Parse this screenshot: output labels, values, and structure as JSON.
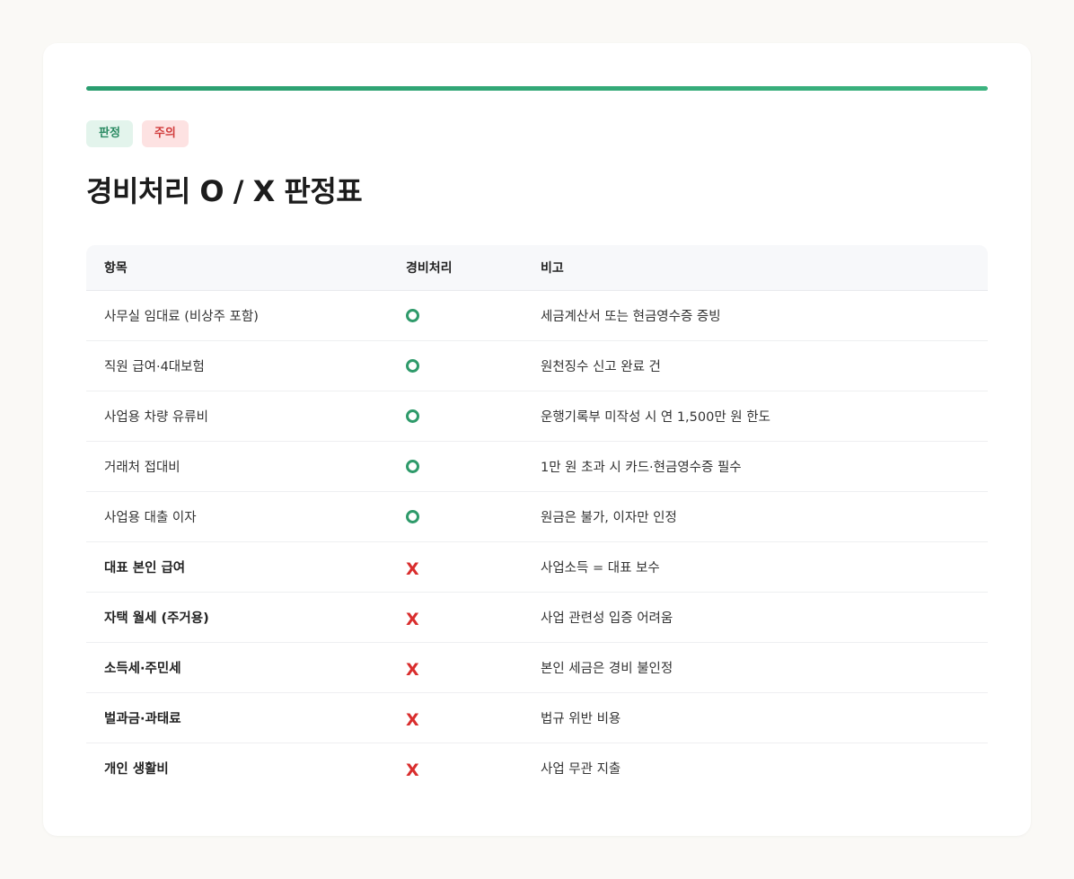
{
  "colors": {
    "accent_start": "#2a9d6f",
    "accent_end": "#3cb37f",
    "positive": "#2e9a6a",
    "negative": "#d92d2d"
  },
  "badges": {
    "verdict": "판정",
    "caution": "주의"
  },
  "title": "경비처리 O / X 판정표",
  "table": {
    "headers": [
      "항목",
      "경비처리",
      "비고"
    ],
    "rows": [
      {
        "item": "사무실 임대료 (비상주 포함)",
        "mark": "O",
        "note": "세금계산서 또는 현금영수증 증빙"
      },
      {
        "item": "직원 급여·4대보험",
        "mark": "O",
        "note": "원천징수 신고 완료 건"
      },
      {
        "item": "사업용 차량 유류비",
        "mark": "O",
        "note": "운행기록부 미작성 시 연 1,500만 원 한도"
      },
      {
        "item": "거래처 접대비",
        "mark": "O",
        "note": "1만 원 초과 시 카드·현금영수증 필수"
      },
      {
        "item": "사업용 대출 이자",
        "mark": "O",
        "note": "원금은 불가, 이자만 인정"
      },
      {
        "item": "대표 본인 급여",
        "mark": "X",
        "note": "사업소득 = 대표 보수"
      },
      {
        "item": "자택 월세 (주거용)",
        "mark": "X",
        "note": "사업 관련성 입증 어려움"
      },
      {
        "item": "소득세·주민세",
        "mark": "X",
        "note": "본인 세금은 경비 불인정"
      },
      {
        "item": "벌과금·과태료",
        "mark": "X",
        "note": "법규 위반 비용"
      },
      {
        "item": "개인 생활비",
        "mark": "X",
        "note": "사업 무관 지출"
      }
    ]
  }
}
